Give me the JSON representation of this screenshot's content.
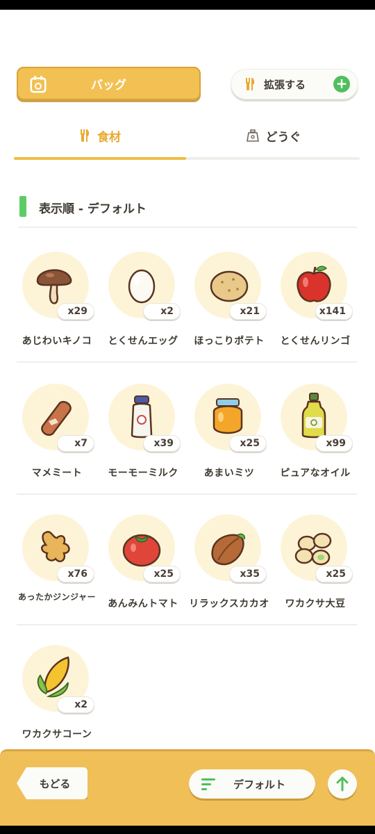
{
  "header": {
    "bag_label": "バッグ",
    "expand_label": "拡張する"
  },
  "tabs": [
    {
      "label": "食材",
      "icon": "fork-knife-icon",
      "active": true
    },
    {
      "label": "どうぐ",
      "icon": "tool-bag-icon",
      "active": false
    }
  ],
  "sort": {
    "title": "表示順 - デフォルト"
  },
  "items": [
    {
      "name": "あじわいキノコ",
      "count": "x29",
      "icon": "mushroom-icon"
    },
    {
      "name": "とくせんエッグ",
      "count": "x2",
      "icon": "egg-icon"
    },
    {
      "name": "ほっこりポテト",
      "count": "x21",
      "icon": "potato-icon"
    },
    {
      "name": "とくせんリンゴ",
      "count": "x141",
      "icon": "apple-icon"
    },
    {
      "name": "マメミート",
      "count": "x7",
      "icon": "sausage-icon"
    },
    {
      "name": "モーモーミルク",
      "count": "x39",
      "icon": "milk-bottle-icon"
    },
    {
      "name": "あまいミツ",
      "count": "x25",
      "icon": "honey-jar-icon"
    },
    {
      "name": "ピュアなオイル",
      "count": "x99",
      "icon": "oil-bottle-icon"
    },
    {
      "name": "あったかジンジャー",
      "count": "x76",
      "icon": "ginger-icon"
    },
    {
      "name": "あんみんトマト",
      "count": "x25",
      "icon": "tomato-icon"
    },
    {
      "name": "リラックスカカオ",
      "count": "x35",
      "icon": "cacao-icon"
    },
    {
      "name": "ワカクサ大豆",
      "count": "x25",
      "icon": "soybean-icon"
    },
    {
      "name": "ワカクサコーン",
      "count": "x2",
      "icon": "corn-icon"
    }
  ],
  "footer": {
    "back_label": "もどる",
    "sort_button_label": "デフォルト"
  },
  "colors": {
    "accent": "#f0bd45",
    "green": "#5ccc67",
    "circle": "#fdf4d7"
  }
}
